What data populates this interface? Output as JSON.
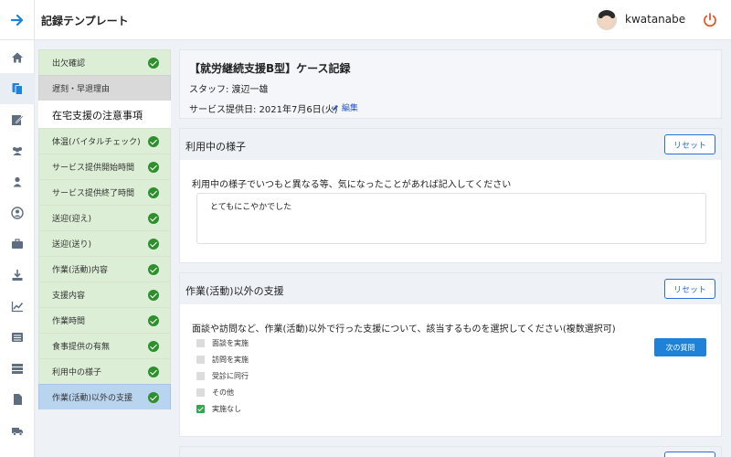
{
  "app": {
    "title": "記録テンプレート",
    "username": "kwatanabe"
  },
  "rail": {
    "items": [
      {
        "icon": "home-icon"
      },
      {
        "icon": "documents-icon",
        "active": true
      },
      {
        "icon": "edit-record-icon"
      },
      {
        "icon": "users-icon"
      },
      {
        "icon": "user-icon"
      },
      {
        "icon": "user-circle-icon"
      },
      {
        "icon": "briefcase-icon"
      },
      {
        "icon": "download-icon"
      },
      {
        "icon": "chart-line-icon"
      },
      {
        "icon": "list-icon"
      },
      {
        "icon": "table-icon"
      },
      {
        "icon": "file-icon"
      },
      {
        "icon": "truck-icon"
      }
    ]
  },
  "steps": [
    {
      "label": "出欠確認",
      "state": "done"
    },
    {
      "label": "遅刻・早退理由",
      "state": "skipped"
    },
    {
      "label": "在宅支援の注意事項",
      "state": "section"
    },
    {
      "label": "体温(バイタルチェック)",
      "state": "done"
    },
    {
      "label": "サービス提供開始時間",
      "state": "done"
    },
    {
      "label": "サービス提供終了時間",
      "state": "done"
    },
    {
      "label": "送迎(迎え)",
      "state": "done"
    },
    {
      "label": "送迎(送り)",
      "state": "done"
    },
    {
      "label": "作業(活動)内容",
      "state": "done"
    },
    {
      "label": "支援内容",
      "state": "done"
    },
    {
      "label": "作業時間",
      "state": "done"
    },
    {
      "label": "食事提供の有無",
      "state": "done"
    },
    {
      "label": "利用中の様子",
      "state": "done"
    },
    {
      "label": "作業(活動)以外の支援",
      "state": "current"
    }
  ],
  "record": {
    "title": "【就労継続支援B型】ケース記録",
    "staff": "スタッフ: 渡辺一雄",
    "date": "サービス提供日: 2021年7月6日(火)",
    "edit_label": "編集"
  },
  "sections": {
    "usage": {
      "title": "利用中の様子",
      "reset_label": "リセット",
      "question": "利用中の様子でいつもと異なる等、気になったことがあれば記入してください",
      "answer": "とてもにこやかでした"
    },
    "support": {
      "title": "作業(活動)以外の支援",
      "reset_label": "リセット",
      "question": "面談や訪問など、作業(活動)以外で行った支援について、該当するものを選択してください(複数選択可)",
      "next_label": "次の質問",
      "options": [
        {
          "label": "面談を実施",
          "checked": false
        },
        {
          "label": "訪問を実施",
          "checked": false
        },
        {
          "label": "受診に同行",
          "checked": false
        },
        {
          "label": "その他",
          "checked": false
        },
        {
          "label": "実施なし",
          "checked": true
        }
      ]
    }
  },
  "colors": {
    "accent": "#2a6fd6",
    "step_done_bg": "#dcefd6",
    "step_current_bg": "#b9d4ee",
    "check_green": "#2f8f2f",
    "power_orange": "#e8572a"
  }
}
